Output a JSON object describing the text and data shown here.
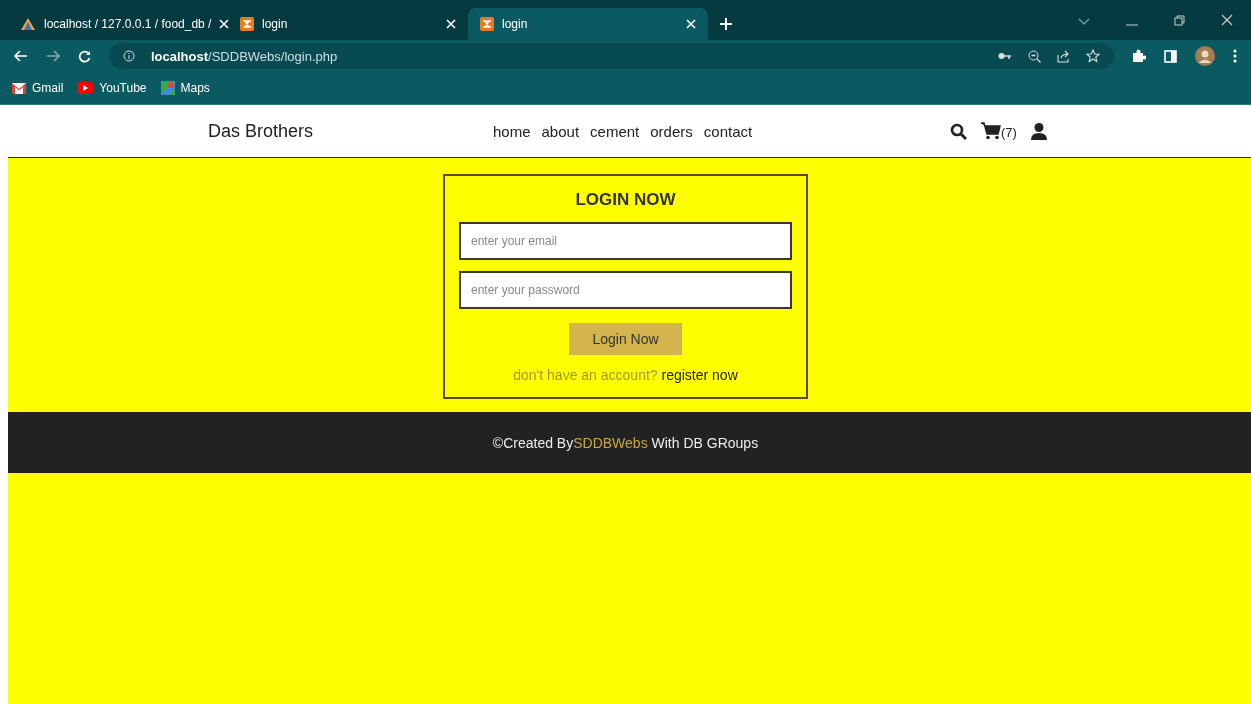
{
  "browser": {
    "tabs": [
      {
        "title": "localhost / 127.0.0.1 / food_db /",
        "selected": false,
        "kind": "db"
      },
      {
        "title": "login",
        "selected": false,
        "kind": "xampp"
      },
      {
        "title": "login",
        "selected": true,
        "kind": "xampp"
      }
    ],
    "address": {
      "host": "localhost",
      "path": "/SDDBWebs/login.php"
    },
    "bookmarks": [
      {
        "label": "Gmail",
        "kind": "gmail"
      },
      {
        "label": "YouTube",
        "kind": "youtube"
      },
      {
        "label": "Maps",
        "kind": "maps"
      }
    ]
  },
  "header": {
    "brand": "Das Brothers",
    "nav": [
      "home",
      "about",
      "cement",
      "orders",
      "contact"
    ],
    "cart_count": "(7)"
  },
  "login": {
    "title": "LOGIN NOW",
    "email_placeholder": "enter your email",
    "password_placeholder": "enter your password",
    "button": "Login Now",
    "prompt": "don't have an account?",
    "link": "register now"
  },
  "footer": {
    "before": "©Created By",
    "brand": "SDDBWebs",
    "after": " With DB GRoups"
  }
}
